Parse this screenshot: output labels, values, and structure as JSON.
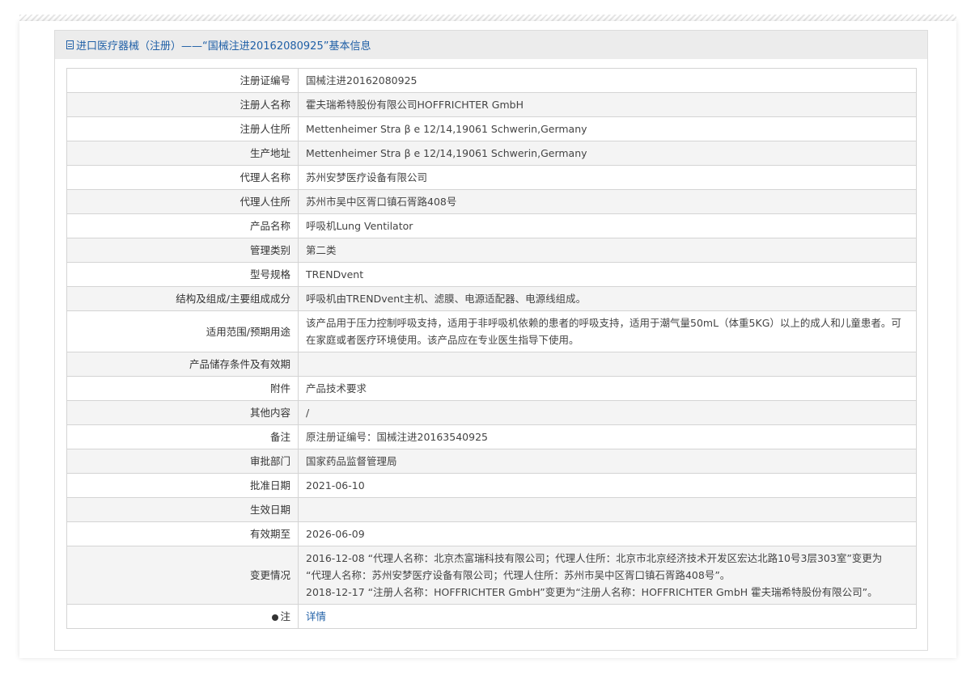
{
  "header": {
    "title": "进口医疗器械（注册）——“国械注进20162080925”基本信息",
    "icon": "document-icon"
  },
  "rows": [
    {
      "label": "注册证编号",
      "value": "国械注进20162080925"
    },
    {
      "label": "注册人名称",
      "value": "霍夫瑞希特股份有限公司HOFFRICHTER GmbH"
    },
    {
      "label": "注册人住所",
      "value": "Mettenheimer Stra β e 12/14,19061 Schwerin,Germany"
    },
    {
      "label": "生产地址",
      "value": "Mettenheimer Stra β e 12/14,19061 Schwerin,Germany"
    },
    {
      "label": "代理人名称",
      "value": "苏州安梦医疗设备有限公司"
    },
    {
      "label": "代理人住所",
      "value": "苏州市吴中区胥口镇石胥路408号"
    },
    {
      "label": "产品名称",
      "value": "呼吸机Lung Ventilator"
    },
    {
      "label": "管理类别",
      "value": "第二类"
    },
    {
      "label": "型号规格",
      "value": "TRENDvent"
    },
    {
      "label": "结构及组成/主要组成成分",
      "value": "呼吸机由TRENDvent主机、滤膜、电源适配器、电源线组成。"
    },
    {
      "label": "适用范围/预期用途",
      "value": "该产品用于压力控制呼吸支持，适用于非呼吸机依赖的患者的呼吸支持，适用于潮气量50mL（体重5KG）以上的成人和儿童患者。可在家庭或者医疗环境使用。该产品应在专业医生指导下使用。"
    },
    {
      "label": "产品储存条件及有效期",
      "value": ""
    },
    {
      "label": "附件",
      "value": "产品技术要求"
    },
    {
      "label": "其他内容",
      "value": "/"
    },
    {
      "label": "备注",
      "value": "原注册证编号：国械注进20163540925"
    },
    {
      "label": "审批部门",
      "value": "国家药品监督管理局"
    },
    {
      "label": "批准日期",
      "value": "2021-06-10"
    },
    {
      "label": "生效日期",
      "value": ""
    },
    {
      "label": "有效期至",
      "value": "2026-06-09"
    }
  ],
  "changes": {
    "label": "变更情况",
    "lines": [
      "2016-12-08 “代理人名称：北京杰富瑞科技有限公司；代理人住所：北京市北京经济技术开发区宏达北路10号3层303室”变更为",
      "“代理人名称：苏州安梦医疗设备有限公司；代理人住所：苏州市吴中区胥口镇石胥路408号”。",
      "2018-12-17 “注册人名称：HOFFRICHTER GmbH”变更为“注册人名称：HOFFRICHTER GmbH 霍夫瑞希特股份有限公司”。"
    ]
  },
  "note": {
    "label": "注",
    "icon": "pin-icon",
    "link_text": "详情"
  }
}
